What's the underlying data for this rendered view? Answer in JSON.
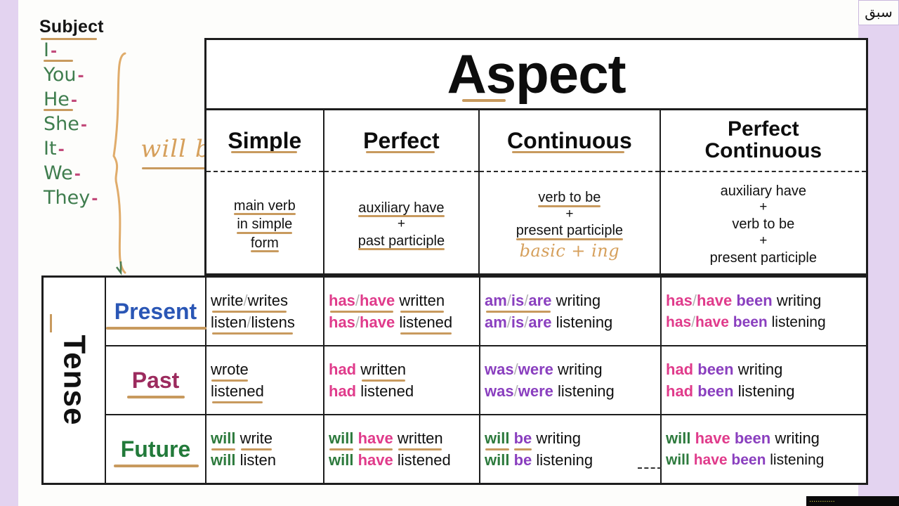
{
  "watermarks": {
    "top_right_arabic": "سبق",
    "bottom_bar": "............"
  },
  "subject": {
    "title": "Subject",
    "pronouns": [
      "I",
      "You",
      "He",
      "She",
      "It",
      "We",
      "They"
    ],
    "annotation": "will be"
  },
  "aspect": {
    "title": "Aspect",
    "columns": [
      {
        "name": "Simple",
        "formula_lines": [
          "main verb",
          "in simple",
          "form"
        ],
        "note": ""
      },
      {
        "name": "Perfect",
        "formula_lines": [
          "auxiliary have",
          "+",
          "past participle"
        ],
        "note": ""
      },
      {
        "name": "Continuous",
        "formula_lines": [
          "verb to be",
          "+",
          "present participle"
        ],
        "note": "basic + ing"
      },
      {
        "name": "Perfect Continuous",
        "name_line1": "Perfect",
        "name_line2": "Continuous",
        "formula_lines": [
          "auxiliary have",
          "+",
          "verb to be",
          "+",
          "present participle"
        ],
        "note": ""
      }
    ]
  },
  "tense": {
    "axis_label": "Tense",
    "rows": [
      {
        "name": "Present",
        "cells": {
          "simple": [
            [
              {
                "t": "write/writes",
                "c": "black",
                "ul": true
              }
            ]
          ],
          "simple2": [
            [
              {
                "t": "listen/listens",
                "c": "black",
                "ul": true
              }
            ]
          ],
          "perfect": [
            [
              {
                "t": "has/have",
                "c": "pink",
                "ul": true
              },
              {
                "t": "written",
                "c": "black",
                "ul": true
              }
            ],
            [
              {
                "t": "has/have",
                "c": "pink",
                "ul": false
              },
              {
                "t": "listened",
                "c": "black",
                "ul": true
              }
            ]
          ],
          "continuous": [
            [
              {
                "t": "am/is/are",
                "c": "purple",
                "ul": true
              },
              {
                "t": "writing",
                "c": "black",
                "ul": false
              }
            ],
            [
              {
                "t": "am/is/are",
                "c": "purple",
                "ul": false
              },
              {
                "t": "listening",
                "c": "black",
                "ul": false
              }
            ]
          ],
          "perfect_continuous": [
            [
              {
                "t": "has/have",
                "c": "pink",
                "ul": false
              },
              {
                "t": "been",
                "c": "purple",
                "ul": false
              },
              {
                "t": "writing",
                "c": "black",
                "ul": false
              }
            ],
            [
              {
                "t": "has/have",
                "c": "pink",
                "ul": false
              },
              {
                "t": "been",
                "c": "purple",
                "ul": false
              },
              {
                "t": "listening",
                "c": "black",
                "ul": false
              }
            ]
          ]
        },
        "simple_lines": [
          [
            {
              "t": "write/writes",
              "c": "black",
              "ul": true
            }
          ],
          [
            {
              "t": "listen/listens",
              "c": "black",
              "ul": true
            }
          ]
        ]
      },
      {
        "name": "Past",
        "simple_lines": [
          [
            {
              "t": "wrote",
              "c": "black",
              "ul": true
            }
          ],
          [
            {
              "t": "listened",
              "c": "black",
              "ul": true
            }
          ]
        ],
        "perfect_lines": [
          [
            {
              "t": "had",
              "c": "pink",
              "ul": false
            },
            {
              "t": "written",
              "c": "black",
              "ul": true
            }
          ],
          [
            {
              "t": "had",
              "c": "pink",
              "ul": false
            },
            {
              "t": "listened",
              "c": "black",
              "ul": false
            }
          ]
        ],
        "continuous_lines": [
          [
            {
              "t": "was/were",
              "c": "purple",
              "ul": false
            },
            {
              "t": "writing",
              "c": "black",
              "ul": false
            }
          ],
          [
            {
              "t": "was/were",
              "c": "purple",
              "ul": false
            },
            {
              "t": "listening",
              "c": "black",
              "ul": false
            }
          ]
        ],
        "perfect_continuous_lines": [
          [
            {
              "t": "had",
              "c": "pink",
              "ul": false
            },
            {
              "t": "been",
              "c": "purple",
              "ul": false
            },
            {
              "t": "writing",
              "c": "black",
              "ul": false
            }
          ],
          [
            {
              "t": "had",
              "c": "pink",
              "ul": false
            },
            {
              "t": "been",
              "c": "purple",
              "ul": false
            },
            {
              "t": "listening",
              "c": "black",
              "ul": false
            }
          ]
        ]
      },
      {
        "name": "Future",
        "simple_lines": [
          [
            {
              "t": "will",
              "c": "green",
              "ul": true
            },
            {
              "t": "write",
              "c": "black",
              "ul": true
            }
          ],
          [
            {
              "t": "will",
              "c": "green",
              "ul": false
            },
            {
              "t": "listen",
              "c": "black",
              "ul": false
            }
          ]
        ],
        "perfect_lines": [
          [
            {
              "t": "will",
              "c": "green",
              "ul": true
            },
            {
              "t": "have",
              "c": "pink",
              "ul": true
            },
            {
              "t": "written",
              "c": "black",
              "ul": true
            }
          ],
          [
            {
              "t": "will",
              "c": "green",
              "ul": false
            },
            {
              "t": "have",
              "c": "pink",
              "ul": false
            },
            {
              "t": "listened",
              "c": "black",
              "ul": false
            }
          ]
        ],
        "continuous_lines": [
          [
            {
              "t": "will",
              "c": "green",
              "ul": true
            },
            {
              "t": "be",
              "c": "purple",
              "ul": true
            },
            {
              "t": "writing",
              "c": "black",
              "ul": false
            }
          ],
          [
            {
              "t": "will",
              "c": "green",
              "ul": false
            },
            {
              "t": "be",
              "c": "purple",
              "ul": false
            },
            {
              "t": "listening",
              "c": "black",
              "ul": false
            }
          ]
        ],
        "perfect_continuous_lines": [
          [
            {
              "t": "will",
              "c": "green",
              "ul": false
            },
            {
              "t": "have",
              "c": "pink",
              "ul": false
            },
            {
              "t": "been",
              "c": "purple",
              "ul": false
            },
            {
              "t": "writing",
              "c": "black",
              "ul": false
            }
          ],
          [
            {
              "t": "will",
              "c": "green",
              "ul": false
            },
            {
              "t": "have",
              "c": "pink",
              "ul": false
            },
            {
              "t": "been",
              "c": "purple",
              "ul": false
            },
            {
              "t": "listening",
              "c": "black",
              "ul": false
            }
          ]
        ]
      }
    ],
    "present_lines": {
      "simple": [
        [
          {
            "t": "write/writes",
            "c": "black",
            "ul": true
          }
        ],
        [
          {
            "t": "listen/listens",
            "c": "black",
            "ul": true
          }
        ]
      ],
      "perfect": [
        [
          {
            "t": "has/have",
            "c": "pink",
            "ul": true
          },
          {
            "t": "written",
            "c": "black",
            "ul": true
          }
        ],
        [
          {
            "t": "has/have",
            "c": "pink",
            "ul": false
          },
          {
            "t": "listened",
            "c": "black",
            "ul": true
          }
        ]
      ],
      "continuous": [
        [
          {
            "t": "am/is/are",
            "c": "purple",
            "ul": true
          },
          {
            "t": "writing",
            "c": "black",
            "ul": false
          }
        ],
        [
          {
            "t": "am/is/are",
            "c": "purple",
            "ul": false
          },
          {
            "t": "listening",
            "c": "black",
            "ul": false
          }
        ]
      ],
      "perfect_continuous": [
        [
          {
            "t": "has/have",
            "c": "pink",
            "ul": false
          },
          {
            "t": "been",
            "c": "purple",
            "ul": false
          },
          {
            "t": "writing",
            "c": "black",
            "ul": false
          }
        ],
        [
          {
            "t": "has/have",
            "c": "pink",
            "ul": false
          },
          {
            "t": "been",
            "c": "purple",
            "ul": false
          },
          {
            "t": "listening",
            "c": "black",
            "ul": false
          }
        ]
      ]
    }
  },
  "colors": {
    "background": "#e3d3f0",
    "paper": "#fdfdfb",
    "ink": "#111111",
    "pink": "#e03b8b",
    "purple": "#8a3fbf",
    "green": "#2d7a3d",
    "blue": "#2a56b5",
    "maroon": "#9c2b5e",
    "highlight": "#c89a5e"
  }
}
